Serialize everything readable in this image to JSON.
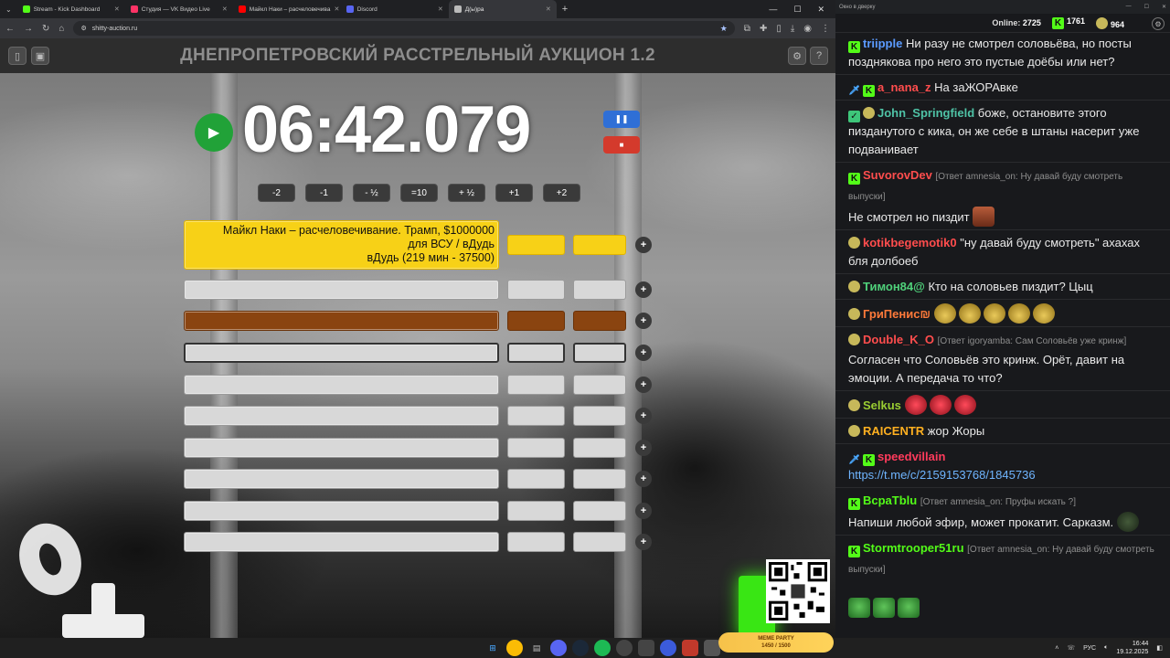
{
  "browser": {
    "tabs": [
      {
        "title": "Stream - Kick Dashboard",
        "favicon": "kick-icon",
        "color": "#53fc18",
        "active": false
      },
      {
        "title": "Студия — VK Видео Live",
        "favicon": "vk-video-icon",
        "color": "#ff3366",
        "active": false
      },
      {
        "title": "Майкл Наки – расчеловечива",
        "favicon": "youtube-icon",
        "color": "#ff0000",
        "active": false
      },
      {
        "title": "Discord",
        "favicon": "discord-icon",
        "color": "#5865f2",
        "active": false
      },
      {
        "title": "Д(ы)ра",
        "favicon": "page-icon",
        "color": "#bbbbbb",
        "active": true
      }
    ],
    "url": "shitty-auction.ru"
  },
  "page": {
    "title": "ДНЕПРОПЕТРОВСКИЙ РАССТРЕЛЬНЫЙ АУКЦИОН 1.2",
    "timer": "06:42.079",
    "adjust_buttons": [
      "-2",
      "-1",
      "- ½",
      "=10",
      "+ ½",
      "+1",
      "+2"
    ],
    "lots": [
      {
        "name": "Майкл Наки – расчеловечивание. Трамп, $1000000\nдля ВСУ / вДудь\nвДудь (219 мин - 37500)",
        "style": "first"
      },
      {
        "name": "",
        "style": "plain"
      },
      {
        "name": "",
        "style": "brown"
      },
      {
        "name": "",
        "style": "dark"
      },
      {
        "name": "",
        "style": "plain"
      },
      {
        "name": "",
        "style": "plain"
      },
      {
        "name": "",
        "style": "plain"
      },
      {
        "name": "",
        "style": "plain"
      },
      {
        "name": "",
        "style": "plain"
      },
      {
        "name": "",
        "style": "plain"
      }
    ],
    "add_label": "+"
  },
  "chat": {
    "window_title": "Окно в дверку",
    "online_label": "Online:",
    "online": "2725",
    "kick_count": "1761",
    "vk_count": "964",
    "messages": [
      {
        "badges": [
          "kick"
        ],
        "user": "triipple",
        "color": "#5b9bff",
        "text": "Ни разу не смотрел соловьёва, но посты позднякова про него это пустые доёбы или нет?"
      },
      {
        "badges": [
          "sword",
          "kick"
        ],
        "user": "a_nana_z",
        "color": "#ff4d4d",
        "text": "На заЖОРАвке"
      },
      {
        "badges": [
          "check",
          "pepe"
        ],
        "user": "John_Springfield",
        "color": "#4fc3a6",
        "text": "боже, остановите этого пизданутого с кика, он же себе в штаны насерит уже подванивает"
      },
      {
        "badges": [
          "kick"
        ],
        "user": "SuvorovDev",
        "color": "#ff4d4d",
        "reply": "[Ответ amnesia_on: Ну давай буду смотреть выпуски]",
        "text": "Не смотрел но пиздит",
        "emotes": [
          "face"
        ]
      },
      {
        "badges": [
          "pepe"
        ],
        "user": "kotikbegemotik0",
        "color": "#ff4d4d",
        "text": "\"ну давай буду смотреть\" ахахах бля долбоеб"
      },
      {
        "badges": [
          "pepe"
        ],
        "user": "Тимон84@",
        "color": "#4fd07a",
        "text": "Кто на соловьев пиздит? Цыц"
      },
      {
        "badges": [
          "pepe"
        ],
        "user": "ГриПенис₪",
        "color": "#ff7a3a",
        "text": "",
        "emotes": [
          "wheel",
          "wheel",
          "wheel",
          "wheel",
          "wheel"
        ]
      },
      {
        "badges": [
          "pepe"
        ],
        "user": "Double_K_O",
        "color": "#ff4d4d",
        "reply": "[Ответ igoryamba: Сам Соловьёв уже кринж]",
        "text": "Согласен что Соловьёв это кринж. Орёт, давит на эмоции. А передача то что?"
      },
      {
        "badges": [
          "pepe"
        ],
        "user": "Selkus",
        "color": "#9acd32",
        "text": "",
        "emotes": [
          "red",
          "red",
          "red"
        ]
      },
      {
        "badges": [
          "pepe"
        ],
        "user": "RAICENTR",
        "color": "#ffb020",
        "text": "жор Жоры"
      },
      {
        "badges": [
          "sword",
          "kick"
        ],
        "user": "speedvillain",
        "color": "#ff3b5c",
        "text": "",
        "link": "https://t.me/c/2159153768/1845736"
      },
      {
        "badges": [
          "kick"
        ],
        "user": "BcpaTblu",
        "color": "#53fc18",
        "reply": "[Ответ amnesia_on: Пруфы искать ?]",
        "text": "Напиши любой эфир, может прокатит. Сарказм.",
        "emotes": [
          "dark"
        ]
      },
      {
        "badges": [
          "kick"
        ],
        "user": "Stormtrooper51ru",
        "color": "#53fc18",
        "reply": "[Ответ amnesia_on: Ну давай буду смотреть выпуски]",
        "text": "",
        "emotes": [
          "pepe",
          "pepe",
          "pepe"
        ]
      }
    ]
  },
  "taskbar": {
    "lang": "РУС",
    "time": "16:44",
    "date": "19.12.2025",
    "meme_title": "MEME PARTY",
    "meme_progress": "1450 / 1500"
  },
  "colors": {
    "kick_green": "#53fc18",
    "lot_yellow": "#f7d117",
    "lot_brown": "#8a4410",
    "play_green": "#21a238",
    "pause_blue": "#2f6fd6",
    "stop_red": "#d43a2c"
  }
}
